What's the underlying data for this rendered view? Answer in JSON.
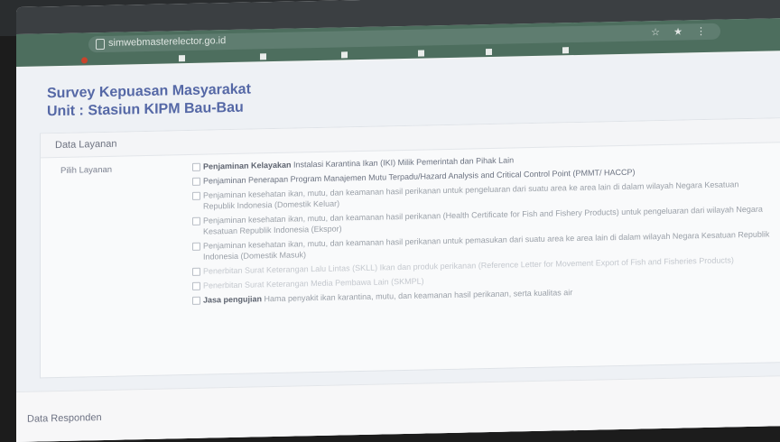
{
  "browser": {
    "url": "simwebmasterelector.go.id",
    "tools": "☆ ★ ⋮",
    "bookmarks": [
      "",
      "",
      "",
      "",
      "",
      "",
      ""
    ]
  },
  "page": {
    "title_line1": "Survey Kepuasan Masyarakat",
    "title_line2": "Unit : Stasiun KIPM Bau-Bau"
  },
  "section_service": {
    "heading": "Data Layanan",
    "field_label": "Pilih Layanan",
    "options": [
      {
        "bold": "Penjaminan Kelayakan",
        "text": " Instalasi Karantina Ikan (IKI) Milik Pemerintah dan Pihak Lain"
      },
      {
        "bold": "",
        "text": "Penjaminan Penerapan Program Manajemen Mutu Terpadu/Hazard Analysis and Critical Control Point (PMMT/ HACCP)"
      },
      {
        "bold": "",
        "text": "Penjaminan kesehatan ikan, mutu, dan keamanan hasil perikanan untuk pengeluaran dari suatu area ke area lain di dalam wilayah Negara Kesatuan Republik Indonesia (Domestik Keluar)"
      },
      {
        "bold": "",
        "text": "Penjaminan kesehatan ikan, mutu, dan keamanan hasil perikanan (Health Certificate for Fish and Fishery Products) untuk pengeluaran dari wilayah Negara Kesatuan Republik Indonesia (Ekspor)"
      },
      {
        "bold": "",
        "text": "Penjaminan kesehatan ikan, mutu, dan keamanan hasil perikanan untuk pemasukan dari suatu area ke area lain di dalam wilayah Negara Kesatuan Republik Indonesia (Domestik Masuk)"
      },
      {
        "bold": "",
        "text": "Penerbitan Surat Keterangan Lalu Lintas (SKLL) Ikan dan produk perikanan (Reference Letter for Movement Export of Fish and Fisheries Products)"
      },
      {
        "bold": "",
        "text": "Penerbitan Surat Keterangan Media Pembawa Lain (SKMPL)"
      },
      {
        "bold": "Jasa pengujian",
        "text": " Hama penyakit ikan karantina, mutu, dan keamanan hasil perikanan, serta kualitas air"
      }
    ]
  },
  "section_respondent": {
    "heading": "Data Responden",
    "hint": ""
  }
}
